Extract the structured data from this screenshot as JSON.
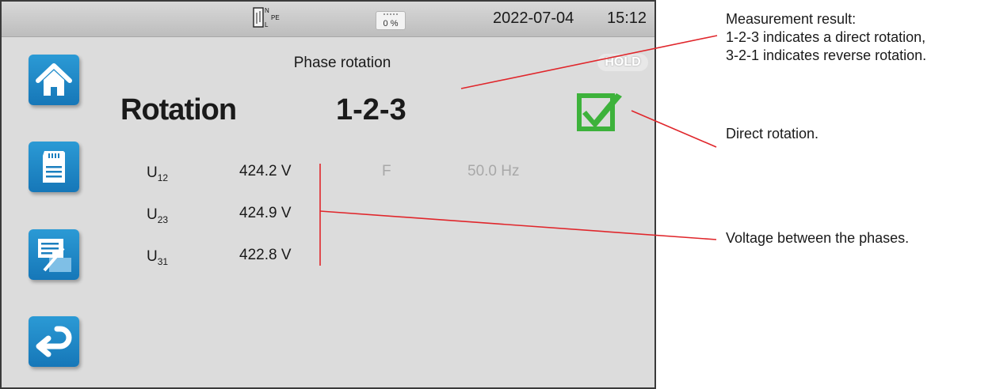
{
  "status_bar": {
    "connection_labels": {
      "n": "N",
      "l": "L",
      "pe": "PE"
    },
    "battery_label": "0 %",
    "date": "2022-07-04",
    "time": "15:12"
  },
  "sidebar": {
    "buttons": [
      {
        "icon": "home-icon"
      },
      {
        "icon": "memory-card-icon"
      },
      {
        "icon": "record-list-icon"
      },
      {
        "icon": "back-arrow-icon"
      }
    ]
  },
  "measurement": {
    "title": "Phase rotation",
    "hold_label": "HOLD",
    "rotation_label": "Rotation",
    "rotation_value": "1-2-3",
    "status_icon": "checkbox-checked-icon",
    "voltages": [
      {
        "name": "U",
        "sub": "12",
        "value": "424.2 V"
      },
      {
        "name": "U",
        "sub": "23",
        "value": "424.9 V"
      },
      {
        "name": "U",
        "sub": "31",
        "value": "422.8 V"
      }
    ],
    "frequency_label": "F",
    "frequency_value": "50.0 Hz"
  },
  "annotations": {
    "result_line1": "Measurement result:",
    "result_line2": "1-2-3 indicates a direct rotation,",
    "result_line3": "3-2-1 indicates reverse rotation.",
    "direct": "Direct rotation.",
    "voltage": "Voltage between the phases."
  },
  "colors": {
    "accent": "#1f87c8",
    "check": "#3db23b",
    "leader": "#e0262b"
  }
}
